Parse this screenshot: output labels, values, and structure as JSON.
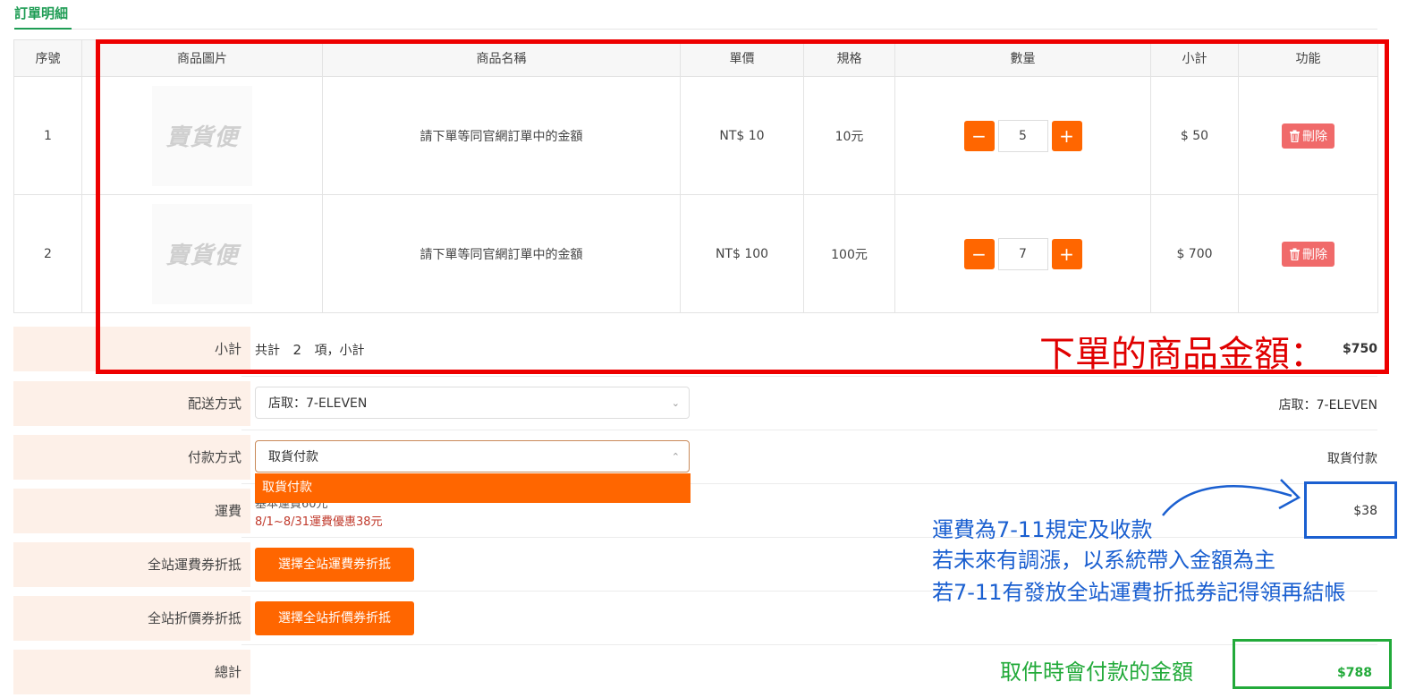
{
  "tab": {
    "label": "訂單明細"
  },
  "columns": [
    "序號",
    "商品圖片",
    "商品名稱",
    "單價",
    "規格",
    "數量",
    "小計",
    "功能"
  ],
  "items": [
    {
      "no": "1",
      "logo": "賣貨便",
      "name": "請下單等同官網訂單中的金額",
      "price": "NT$ 10",
      "spec": "10元",
      "minus": "−",
      "qty": "5",
      "plus": "+",
      "subtotal": "$ 50",
      "delete_label": "刪除"
    },
    {
      "no": "2",
      "logo": "賣貨便",
      "name": "請下單等同官網訂單中的金額",
      "price": "NT$ 100",
      "spec": "100元",
      "minus": "−",
      "qty": "7",
      "plus": "+",
      "subtotal": "$ 700",
      "delete_label": "刪除"
    }
  ],
  "summary": {
    "subtotal_label": "小計",
    "count_prefix": "共計",
    "count": "2",
    "count_suffix": "項，小計",
    "subtotal_value": "$750",
    "shipping_method_label": "配送方式",
    "shipping_method_value": "店取：7-ELEVEN",
    "payment_method_label": "付款方式",
    "payment_method_value": "取貨付款",
    "payment_option": "取貨付款",
    "shipping_fee_label": "運費",
    "shipping_fee_base": "基本運費60元",
    "shipping_fee_promo": "8/1~8/31運費優惠38元",
    "shipping_fee_value": "$38",
    "ship_coupon_label": "全站運費券折抵",
    "ship_coupon_button": "選擇全站運費券折抵",
    "price_coupon_label": "全站折價券折抵",
    "price_coupon_button": "選擇全站折價券折抵",
    "total_label": "總計",
    "total_value": "$788"
  },
  "annotations": {
    "red": "下單的商品金額：",
    "blue_lines": [
      "運費為7-11規定及收款",
      "若未來有調漲，以系統帶入金額為主",
      "若7-11有發放全站運費折抵券記得領再結帳"
    ],
    "green": "取件時會付款的金額"
  },
  "colors": {
    "accent": "#ff6600",
    "label_bg": "#fdf0e8",
    "tab": "#1f9d55",
    "annot_red": "#ee0000",
    "annot_blue": "#1a5fd0",
    "annot_green": "#22aa3a",
    "delete": "#f06a6a"
  }
}
